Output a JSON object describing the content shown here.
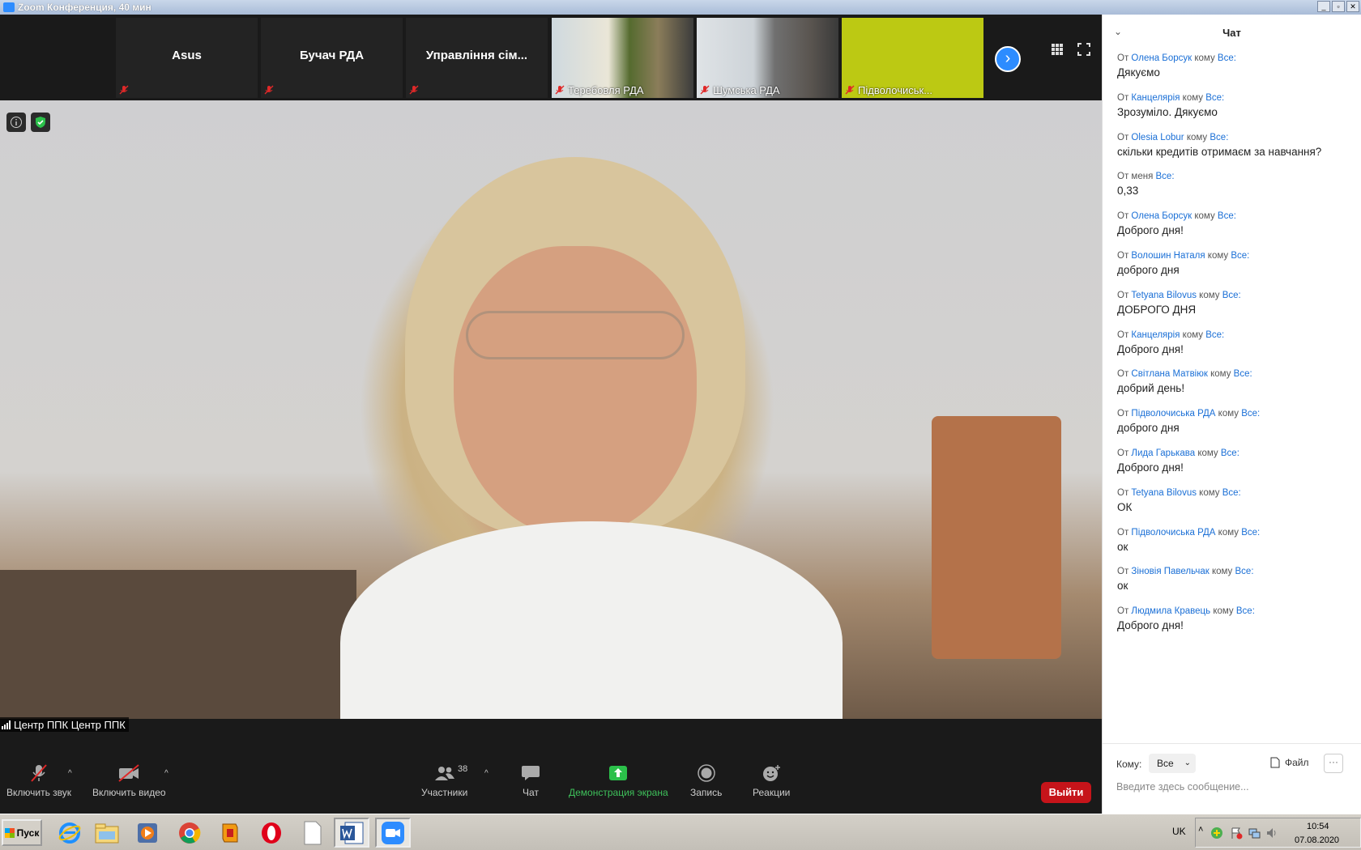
{
  "window": {
    "title": "Zoom Конференция, 40 мин",
    "buttons": [
      "_",
      "▫",
      "✕"
    ]
  },
  "thumbnails": [
    {
      "name": "Asus",
      "style": "name-only"
    },
    {
      "name": "Бучач РДА",
      "style": "name-only"
    },
    {
      "name": "Управління сім...",
      "style": "name-only"
    },
    {
      "name": "Теребовля РДА",
      "style": "video"
    },
    {
      "name": "Шумська РДА",
      "style": "video"
    },
    {
      "name": "Підволочиськ...",
      "style": "video"
    }
  ],
  "main_video": {
    "speaker_label": "Центр ППК Центр ППК"
  },
  "toolbar": {
    "unmute_label": "Включить звук",
    "start_video_label": "Включить видео",
    "participants_label": "Участники",
    "participants_count": "38",
    "chat_label": "Чат",
    "share_label": "Демонстрация экрана",
    "record_label": "Запись",
    "reactions_label": "Реакции",
    "leave_label": "Выйти"
  },
  "chat": {
    "title": "Чат",
    "messages": [
      {
        "from": "Олена Борсук",
        "to": "Все:",
        "text": "Дякуємо"
      },
      {
        "from": "Канцелярія",
        "to": "Все:",
        "text": "Зрозуміло. Дякуємо"
      },
      {
        "from": "Olesia Lobur",
        "to": "Все:",
        "text": "скільки кредитів отримаєм за навчання?"
      },
      {
        "from": "меня",
        "to": "Все:",
        "text": "0,33",
        "self": true
      },
      {
        "from": "Олена Борсук",
        "to": "Все:",
        "text": "Доброго дня!"
      },
      {
        "from": "Волошин Наталя",
        "to": "Все:",
        "text": "доброго дня"
      },
      {
        "from": "Tetyana Bilovus",
        "to": "Все:",
        "text": "ДОБРОГО ДНЯ"
      },
      {
        "from": "Канцелярія",
        "to": "Все:",
        "text": "Доброго дня!"
      },
      {
        "from": "Світлана Матвіюк",
        "to": "Все:",
        "text": "добрий день!"
      },
      {
        "from": "Підволочиська РДА",
        "to": "Все:",
        "text": "доброго дня"
      },
      {
        "from": "Лида Гарькава",
        "to": "Все:",
        "text": "Доброго дня!"
      },
      {
        "from": "Tetyana Bilovus",
        "to": "Все:",
        "text": "ОК"
      },
      {
        "from": "Підволочиська РДА",
        "to": "Все:",
        "text": "ок"
      },
      {
        "from": "Зіновія Павельчак",
        "to": "Все:",
        "text": "ок"
      },
      {
        "from": "Людмила Кравець",
        "to": "Все:",
        "text": "Доброго  дня!"
      }
    ],
    "from_word": "От",
    "to_word": "кому",
    "to_label": "Кому:",
    "to_value": "Все",
    "file_label": "Файл",
    "more_label": "···",
    "input_placeholder": "Введите здесь сообщение..."
  },
  "taskbar": {
    "start_label": "Пуск",
    "apps": [
      "ie-icon",
      "explorer-icon",
      "media-player-icon",
      "chrome-icon",
      "app-icon",
      "opera-icon",
      "document-icon",
      "word-icon",
      "zoom-icon"
    ],
    "language": "UK",
    "time": "10:54",
    "date": "07.08.2020"
  }
}
